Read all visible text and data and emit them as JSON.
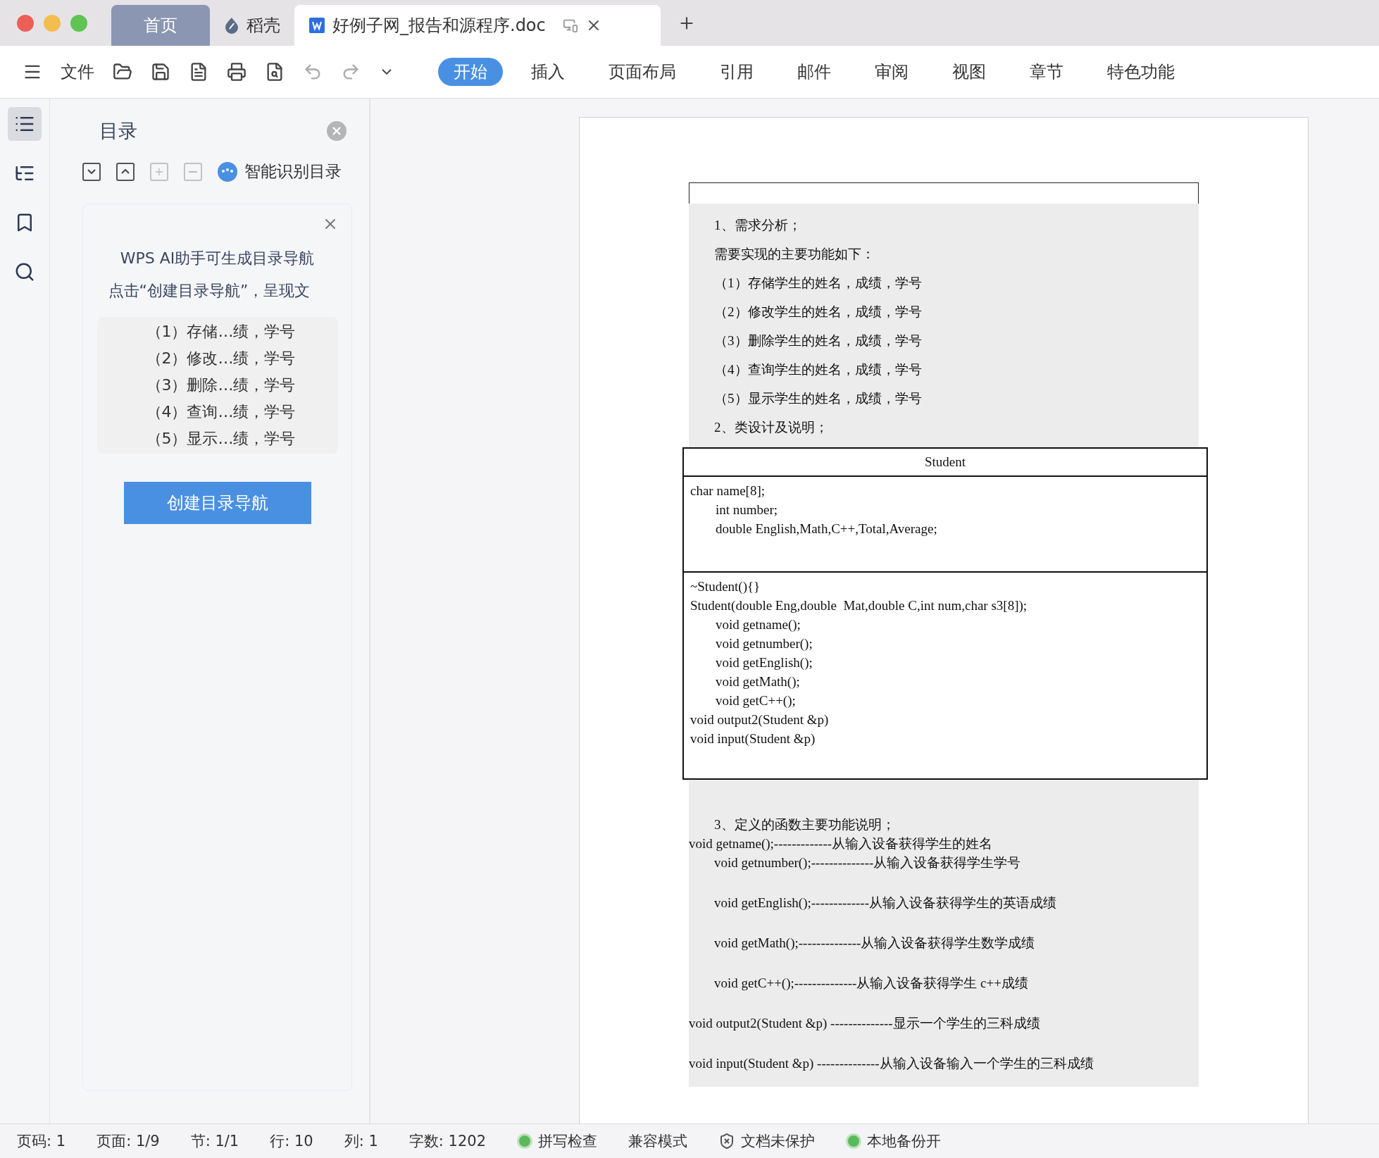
{
  "tabs": [
    {
      "label": "首页",
      "kind": "home",
      "selected": false
    },
    {
      "label": "稻壳",
      "kind": "store",
      "selected": false
    },
    {
      "label": "好例子网_报告和源程序.doc",
      "kind": "document",
      "selected": true
    }
  ],
  "toolbar": {
    "file_menu": "文件",
    "ribbon_tabs": [
      {
        "label": "开始",
        "selected": true
      },
      {
        "label": "插入",
        "selected": false
      },
      {
        "label": "页面布局",
        "selected": false
      },
      {
        "label": "引用",
        "selected": false
      },
      {
        "label": "邮件",
        "selected": false
      },
      {
        "label": "审阅",
        "selected": false
      },
      {
        "label": "视图",
        "selected": false
      },
      {
        "label": "章节",
        "selected": false
      },
      {
        "label": "特色功能",
        "selected": false
      }
    ]
  },
  "sidebar": {
    "title": "目录",
    "smart_toc": "智能识别目录",
    "ai_card": {
      "headline": "WPS AI助手可生成目录导航",
      "description": "点击“创建目录导航”，呈现文",
      "preview_items": [
        "（1）存储…绩，学号",
        "（2）修改…绩，学号",
        "（3）删除…绩，学号",
        "（4）查询…绩，学号",
        "（5）显示…绩，学号"
      ],
      "button": "创建目录导航"
    }
  },
  "document": {
    "intro": [
      {
        "text": "1、需求分析；",
        "indented": true
      },
      {
        "text": "需要实现的主要功能如下：",
        "indented": true
      },
      {
        "text": "（1）存储学生的姓名，成绩，学号",
        "indented": true
      },
      {
        "text": "（2）修改学生的姓名，成绩，学号",
        "indented": true
      },
      {
        "text": "（3）删除学生的姓名，成绩，学号",
        "indented": true
      },
      {
        "text": "（4）查询学生的姓名，成绩，学号",
        "indented": true
      },
      {
        "text": "（5）显示学生的姓名，成绩，学号",
        "indented": true
      },
      {
        "text": "2、类设计及说明；",
        "indented": true
      }
    ],
    "class_table": {
      "name": "Student",
      "attributes": [
        {
          "text": "char name[8];",
          "indented": false
        },
        {
          "text": "int number;",
          "indented": true
        },
        {
          "text": "double English,Math,C++,Total,Average;",
          "indented": true
        }
      ],
      "methods": [
        {
          "text": "~Student(){}",
          "indented": false
        },
        {
          "text": "Student(double Eng,double  Mat,double C,int num,char s3[8]);",
          "indented": false
        },
        {
          "text": "void getname();",
          "indented": true
        },
        {
          "text": "void getnumber();",
          "indented": true
        },
        {
          "text": "void getEnglish();",
          "indented": true
        },
        {
          "text": "void getMath();",
          "indented": true
        },
        {
          "text": "void getC++();",
          "indented": true
        },
        {
          "text": "void output2(Student &p)",
          "indented": false
        },
        {
          "text": "void input(Student &p)",
          "indented": false
        }
      ]
    },
    "functions": [
      {
        "text": "3、定义的函数主要功能说明；",
        "indented": true,
        "gap": false
      },
      {
        "text": "void getname();-------------从输入设备获得学生的姓名",
        "indented": false,
        "gap": false
      },
      {
        "text": "void getnumber();--------------从输入设备获得学生学号",
        "indented": true,
        "gap": false
      },
      {
        "text": "void getEnglish();-------------从输入设备获得学生的英语成绩",
        "indented": true,
        "gap": true
      },
      {
        "text": "void getMath();--------------从输入设备获得学生数学成绩",
        "indented": true,
        "gap": true
      },
      {
        "text": "void getC++();--------------从输入设备获得学生 c++成绩",
        "indented": true,
        "gap": true
      },
      {
        "text": "void output2(Student &p) --------------显示一个学生的三科成绩",
        "indented": false,
        "gap": true
      },
      {
        "text": "void input(Student &p) --------------从输入设备输入一个学生的三科成绩",
        "indented": false,
        "gap": true
      }
    ]
  },
  "status_bar": [
    {
      "text": "页码: 1",
      "kind": "text"
    },
    {
      "text": "页面: 1/9",
      "kind": "text"
    },
    {
      "text": "节: 1/1",
      "kind": "text"
    },
    {
      "text": "行: 10",
      "kind": "text"
    },
    {
      "text": "列: 1",
      "kind": "text"
    },
    {
      "text": "字数: 1202",
      "kind": "text"
    },
    {
      "text": "拼写检查",
      "kind": "toggle"
    },
    {
      "text": "兼容模式",
      "kind": "text"
    },
    {
      "text": "文档未保护",
      "kind": "protection"
    },
    {
      "text": "本地备份开",
      "kind": "toggle"
    }
  ]
}
